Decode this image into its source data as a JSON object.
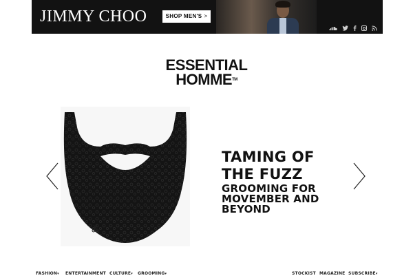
{
  "ad": {
    "brand": "JIMMY CHOO",
    "cta_label": "SHOP MEN'S",
    "cta_chevron": ">",
    "socials": [
      "soundcloud-icon",
      "twitter-icon",
      "facebook-icon",
      "instagram-icon",
      "rss-icon"
    ]
  },
  "site": {
    "logo_line1": "ESSENTIAL",
    "logo_line2": "HOMME",
    "logo_tm": "TM"
  },
  "hero": {
    "title": "TAMING OF THE FUZZ",
    "subtitle": "GROOMING FOR MOVEMBER AND BEYOND",
    "image_icon": "beard-illustration",
    "prev_icon": "chevron-left-icon",
    "next_icon": "chevron-right-icon"
  },
  "nav": {
    "left": [
      {
        "label": "FASHION",
        "has_dropdown": true
      },
      {
        "label": "ENTERTAINMENT",
        "has_dropdown": false
      },
      {
        "label": "CULTURE",
        "has_dropdown": true
      },
      {
        "label": "GROOMING",
        "has_dropdown": true
      }
    ],
    "right": [
      {
        "label": "STOCKIST",
        "has_dropdown": false
      },
      {
        "label": "MAGAZINE",
        "has_dropdown": false
      },
      {
        "label": "SUBSCRIBE",
        "has_dropdown": true
      }
    ],
    "caret": "▾"
  },
  "colors": {
    "banner_bg": "#121212",
    "text": "#111111",
    "background": "#ffffff"
  }
}
